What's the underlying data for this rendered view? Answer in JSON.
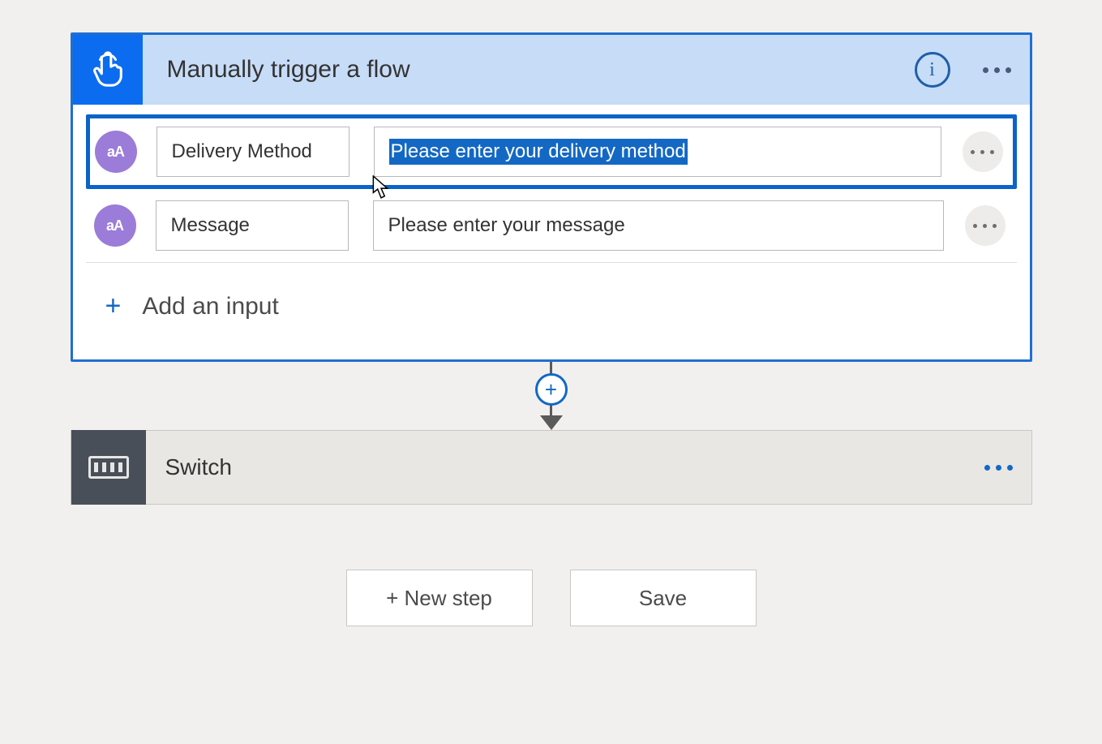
{
  "trigger": {
    "title": "Manually trigger a flow",
    "add_input_label": "Add an input",
    "inputs": [
      {
        "icon_text": "aA",
        "name": "Delivery Method",
        "description": "Please enter your delivery method",
        "selected": true
      },
      {
        "icon_text": "aA",
        "name": "Message",
        "description": "Please enter your message",
        "selected": false
      }
    ]
  },
  "action": {
    "title": "Switch"
  },
  "footer": {
    "new_step": "+ New step",
    "save": "Save"
  }
}
